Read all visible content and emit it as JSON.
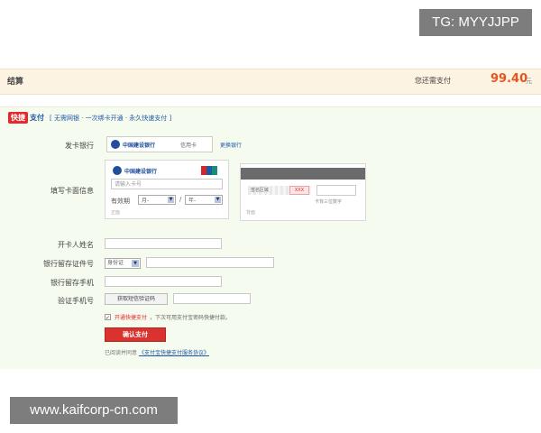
{
  "watermarks": {
    "top": "TG: MYYJJPP",
    "bottom": "www.kaifcorp-cn.com"
  },
  "summary": {
    "title": "结算",
    "amount_label": "您还需支付",
    "amount": "99.40",
    "unit": "元"
  },
  "brand": {
    "badge": "快捷",
    "word": "支付",
    "slogan": "[ 无需网银 · 一次绑卡开通 · 永久快速支付 ]"
  },
  "labels": {
    "bank": "发卡银行",
    "card_info": "填写卡面信息",
    "holder_name": "开卡人姓名",
    "id_number": "银行留存证件号",
    "bank_phone": "银行留存手机",
    "verify_phone": "验证手机号"
  },
  "bank_select": {
    "bank_name": "中国建设银行",
    "card_type": "信用卡",
    "change_link": "更换银行"
  },
  "card_front": {
    "bank_name": "中国建设银行",
    "number_placeholder": "请输入卡号",
    "expiry_label": "有效期",
    "month_placeholder": "月-",
    "year_placeholder": "年-",
    "separator": "/",
    "side_label": "正面"
  },
  "card_back": {
    "sign_text": "签名区域",
    "cvv_sample": "XXX",
    "cvv_hint": "卡背三位数字",
    "side_label": "背面"
  },
  "id_type": {
    "selected": "身份证"
  },
  "verify": {
    "get_code_label": "获取短信验证码"
  },
  "agree": {
    "check_mark": "✓",
    "open_label": "开通快捷支付",
    "note": "，下次可用支付宝密码快捷付款。"
  },
  "confirm_label": "确认支付",
  "agreement": {
    "prefix": "已阅读并同意",
    "link": "《支付宝快捷支付服务协议》"
  },
  "colors": {
    "panel_bg": "#f6fbef",
    "summary_bg": "#fdf3e2",
    "amount": "#e4561f",
    "confirm_button": "#d9322f",
    "link": "#1f5aa8"
  }
}
